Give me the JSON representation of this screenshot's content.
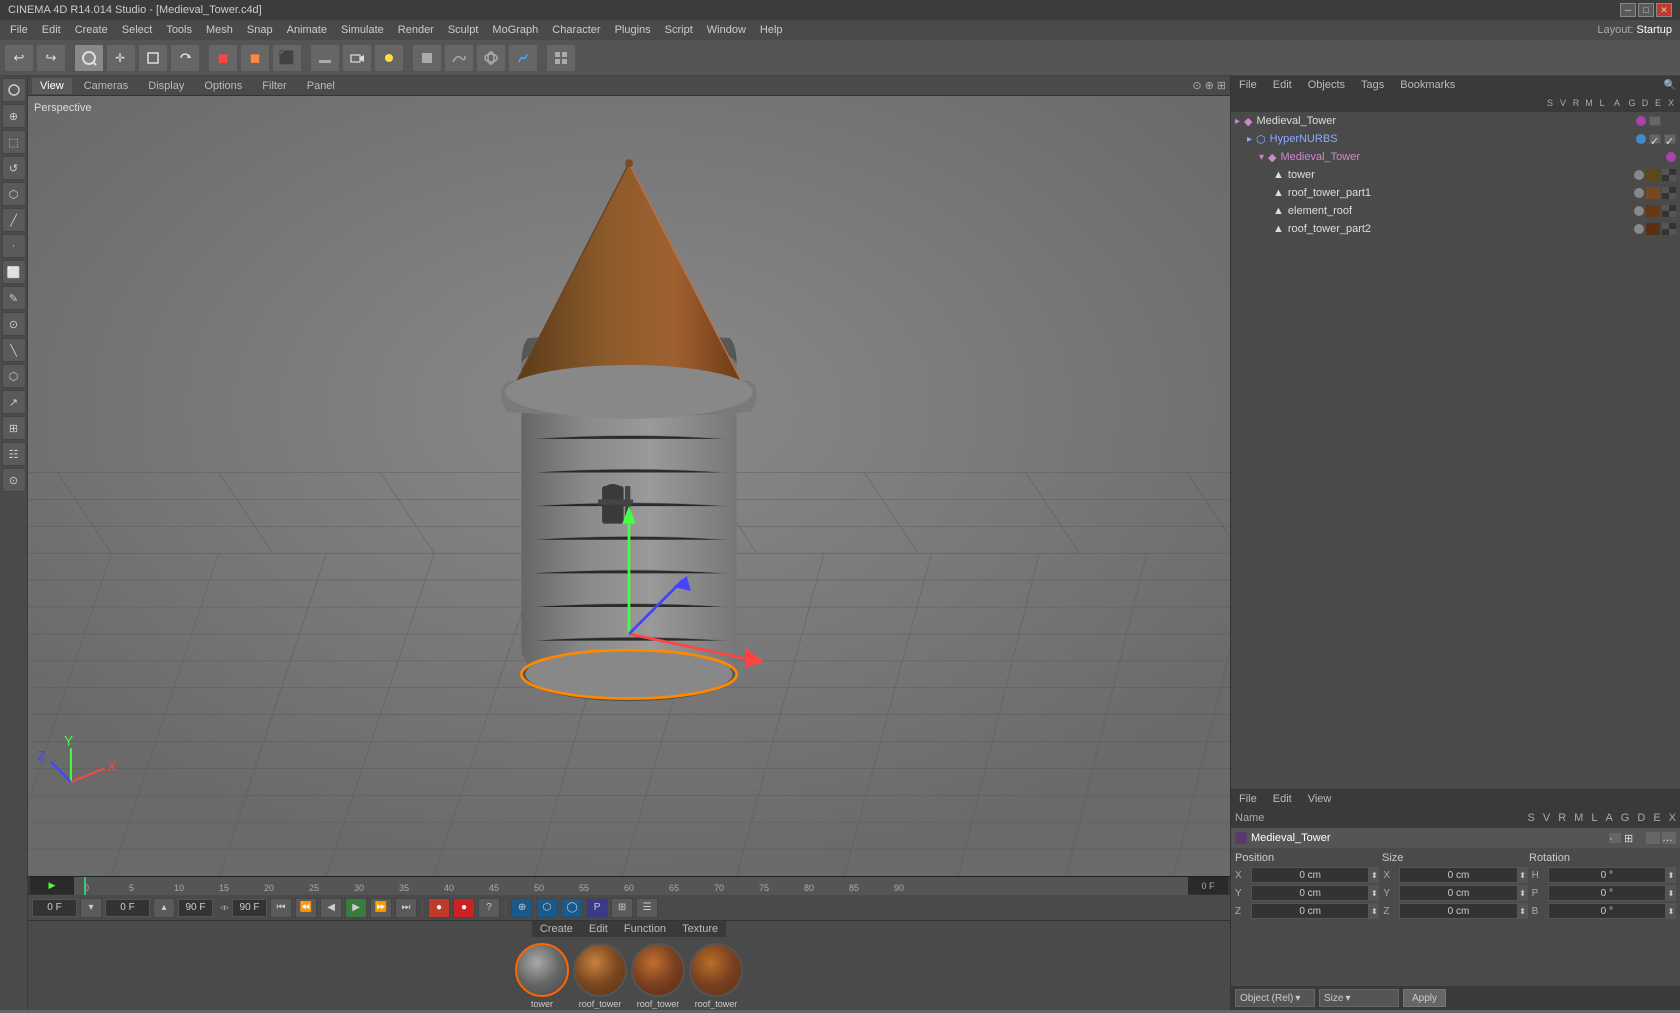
{
  "window": {
    "title": "CINEMA 4D R14.014 Studio - [Medieval_Tower.c4d]",
    "layout_label": "Layout:",
    "layout_value": "Startup"
  },
  "menubar": {
    "items": [
      "File",
      "Edit",
      "Create",
      "Select",
      "Tools",
      "Mesh",
      "Snap",
      "Animate",
      "Simulate",
      "Render",
      "Sculpt",
      "MoGraph",
      "Character",
      "Plugins",
      "Script",
      "Window",
      "Help"
    ]
  },
  "toolbar": {
    "buttons": [
      "↩",
      "↪",
      "✛",
      "⬜",
      "↺",
      "🔴",
      "🔵",
      "🟢",
      "⬛",
      "►",
      "◆",
      "⬡",
      "⬣",
      "⌂",
      "⊕",
      "⊗",
      "◯",
      "⬡",
      "☷",
      "⊞",
      "⊡",
      "☰",
      "⊙",
      "⬡",
      "⊞"
    ]
  },
  "left_toolbar": {
    "buttons": [
      "⊕",
      "⬚",
      "⬛",
      "✕",
      "⬜",
      "⬡",
      "⌂",
      "◆",
      "◯",
      "△",
      "⬡",
      "⊞",
      "↗",
      "↺",
      "⊙",
      "☷"
    ]
  },
  "viewport": {
    "label": "Perspective",
    "tabs": [
      "View",
      "Cameras",
      "Display",
      "Options",
      "Filter",
      "Panel"
    ]
  },
  "object_manager": {
    "menus": [
      "File",
      "Edit",
      "Objects",
      "Tags",
      "Bookmarks"
    ],
    "header_cols": [
      "S",
      "V",
      "R",
      "M",
      "L",
      "A",
      "G",
      "D",
      "E",
      "X"
    ],
    "objects": [
      {
        "name": "Medieval_Tower",
        "level": 0,
        "type": "null",
        "selected": false,
        "color": "#8800aa"
      },
      {
        "name": "HyperNURBS",
        "level": 1,
        "type": "nurbs",
        "selected": false,
        "color": "#2255cc"
      },
      {
        "name": "Medieval_Tower",
        "level": 2,
        "type": "null",
        "selected": false,
        "color": "#8800aa"
      },
      {
        "name": "tower",
        "level": 3,
        "type": "mesh",
        "selected": false,
        "color": "#888888"
      },
      {
        "name": "roof_tower_part1",
        "level": 3,
        "type": "mesh",
        "selected": false,
        "color": "#888888"
      },
      {
        "name": "element_roof",
        "level": 3,
        "type": "mesh",
        "selected": false,
        "color": "#888888"
      },
      {
        "name": "roof_tower_part2",
        "level": 3,
        "type": "mesh",
        "selected": false,
        "color": "#888888"
      }
    ]
  },
  "attribute_manager": {
    "menus": [
      "File",
      "Edit",
      "View"
    ],
    "header_cols": {
      "name": "Name",
      "s": "S",
      "v": "V",
      "r": "R",
      "m": "M",
      "l": "L",
      "a": "A",
      "g": "G",
      "d": "D",
      "e": "E",
      "x": "X"
    },
    "selected_object": "Medieval_Tower",
    "position": {
      "x": "0 cm",
      "y": "0 cm",
      "z": "0 cm"
    },
    "size": {
      "x": "0 cm",
      "y": "0 cm",
      "z": "0 cm"
    },
    "rotation": {
      "h": "0 °",
      "p": "0 °",
      "b": "0 °"
    },
    "mode_dropdown": "Object (Rel)",
    "size_dropdown": "Size",
    "apply_label": "Apply"
  },
  "timeline": {
    "frame": "0 F",
    "end_frame": "90 F",
    "ticks": [
      "0",
      "5",
      "10",
      "15",
      "20",
      "25",
      "30",
      "35",
      "40",
      "45",
      "50",
      "55",
      "60",
      "65",
      "70",
      "75",
      "80",
      "85",
      "90"
    ]
  },
  "transport": {
    "current_frame": "0 F",
    "frame_input": "0 F",
    "min_frame": "90 F",
    "max_frame": "90 F"
  },
  "material_bar": {
    "menus": [
      "Create",
      "Edit",
      "Function",
      "Texture"
    ],
    "materials": [
      {
        "name": "tower",
        "type": "stone"
      },
      {
        "name": "roof_tower",
        "type": "wood"
      },
      {
        "name": "roof_tower",
        "type": "wood2"
      },
      {
        "name": "roof_tower",
        "type": "wood3"
      }
    ]
  }
}
